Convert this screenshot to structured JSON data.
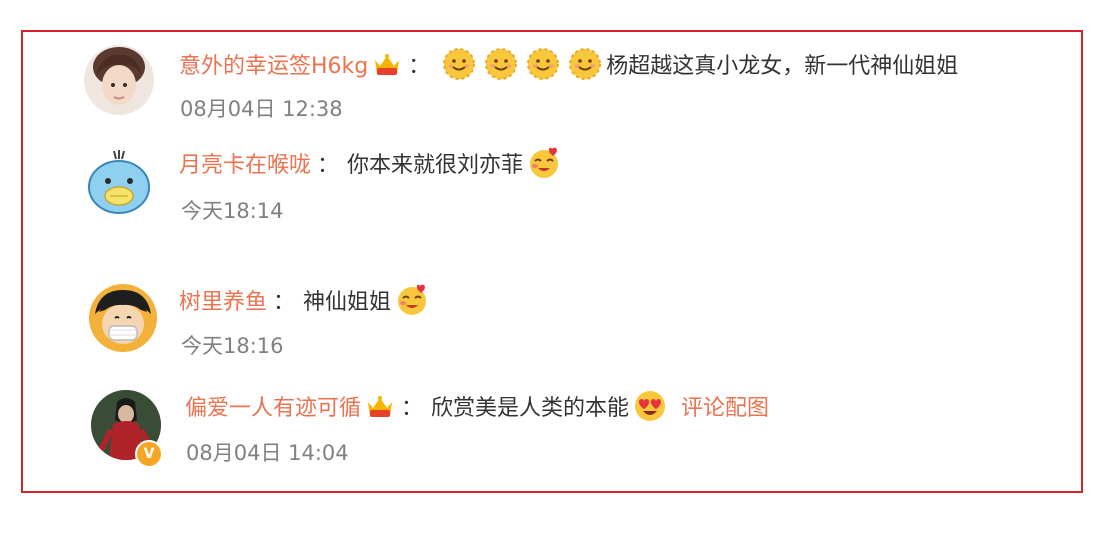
{
  "comments": [
    {
      "user": "意外的幸运签H6kg",
      "colon": "：",
      "text": "杨超越这真小龙女，新一代神仙姐姐",
      "time": "08月04日 12:38",
      "badge_icon": "crown-badge-icon",
      "emojis": [
        "smile-emoji",
        "smile-emoji",
        "smile-emoji",
        "smile-emoji"
      ]
    },
    {
      "user": "月亮卡在喉咙",
      "colon": "：",
      "text": "你本来就很刘亦菲",
      "time": "今天18:14",
      "emojis": [
        "love-face-emoji"
      ]
    },
    {
      "user": "树里养鱼",
      "colon": "：",
      "text": "神仙姐姐",
      "time": "今天18:16",
      "emojis": [
        "love-face-emoji"
      ]
    },
    {
      "user": "偏爱一人有迹可循",
      "colon": "：",
      "text": "欣赏美是人类的本能",
      "link": "评论配图",
      "time": "08月04日 14:04",
      "badge_icon": "crown-badge-icon",
      "verified_badge": "V",
      "emojis": [
        "heart-eyes-emoji"
      ]
    }
  ],
  "colors": {
    "frame_border": "#d2232a",
    "username": "#eb7350",
    "timestamp": "#808080",
    "verified": "#f5a623"
  }
}
